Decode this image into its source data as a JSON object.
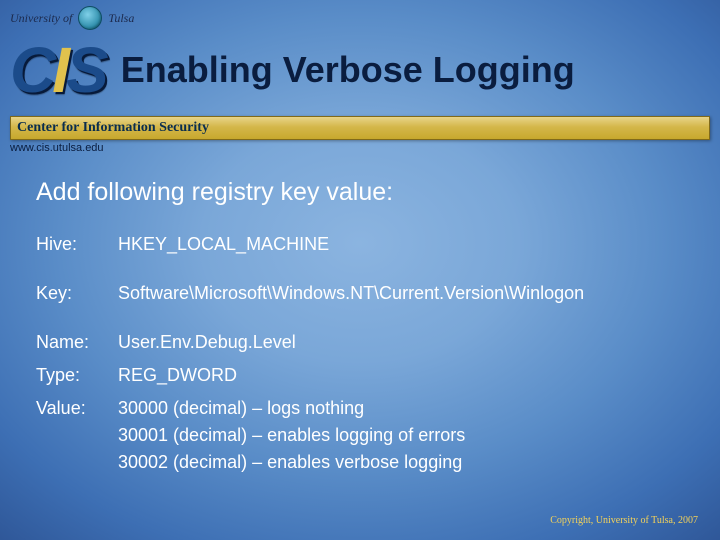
{
  "header": {
    "university_of": "University of",
    "university_name": "Tulsa",
    "logo_letters": {
      "c": "C",
      "i": "I",
      "s": "S"
    },
    "slide_title": "Enabling Verbose Logging",
    "center_bar": "Center for Information Security",
    "site_url": "www.cis.utulsa.edu"
  },
  "body": {
    "lead": "Add following registry key value:",
    "rows": {
      "hive": {
        "label": "Hive:",
        "value": "HKEY_LOCAL_MACHINE"
      },
      "key": {
        "label": "Key:",
        "value": "Software\\Microsoft\\Windows.NT\\Current.Version\\Winlogon"
      },
      "name": {
        "label": "Name:",
        "value": "User.Env.Debug.Level"
      },
      "type": {
        "label": "Type:",
        "value": "REG_DWORD"
      },
      "value": {
        "label": "Value:",
        "value": "30000 (decimal) – logs nothing\n30001 (decimal) – enables logging of errors\n30002 (decimal) – enables verbose logging"
      }
    }
  },
  "footer": {
    "copyright": "Copyright, University of Tulsa, 2007"
  }
}
